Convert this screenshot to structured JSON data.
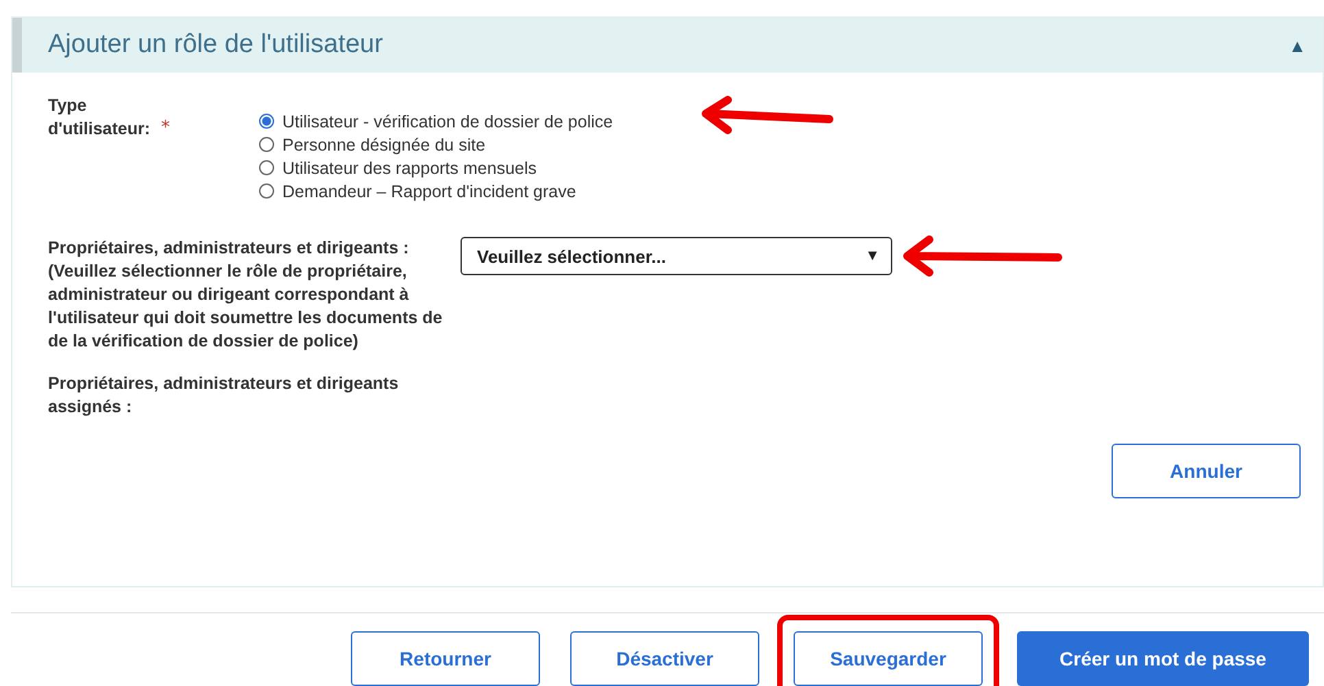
{
  "panel": {
    "title": "Ajouter un rôle de l'utilisateur",
    "collapse_icon": "▲"
  },
  "user_type": {
    "label_lines": [
      "Type",
      "d'utilisateur:"
    ],
    "required_mark": "*",
    "options": [
      {
        "label": "Utilisateur - vérification de dossier de police",
        "selected": true,
        "annotated": true
      },
      {
        "label": "Personne désignée du site",
        "selected": false,
        "annotated": false
      },
      {
        "label": "Utilisateur des rapports mensuels",
        "selected": false,
        "annotated": false
      },
      {
        "label": "Demandeur – Rapport d'incident grave",
        "selected": false,
        "annotated": false
      }
    ]
  },
  "owners": {
    "label": "Propriétaires, administrateurs et dirigeants :",
    "hint": "(Veuillez sélectionner le rôle de propriétaire, administrateur ou dirigeant correspondant à l'utilisateur qui doit soumettre les documents de de la vérification de dossier de police)",
    "select_value": "Veuillez sélectionner...",
    "select_caret": "▼",
    "annotated": true
  },
  "assigned": {
    "label": "Propriétaires, administrateurs et dirigeants assignés :"
  },
  "cancel_button": "Annuler",
  "footer_buttons": [
    {
      "label": "Retourner",
      "kind": "outline",
      "annotated": false
    },
    {
      "label": "Désactiver",
      "kind": "outline",
      "annotated": false
    },
    {
      "label": "Sauvegarder",
      "kind": "outline",
      "annotated": true
    },
    {
      "label": "Créer un mot de passe",
      "kind": "primary",
      "annotated": false
    }
  ]
}
